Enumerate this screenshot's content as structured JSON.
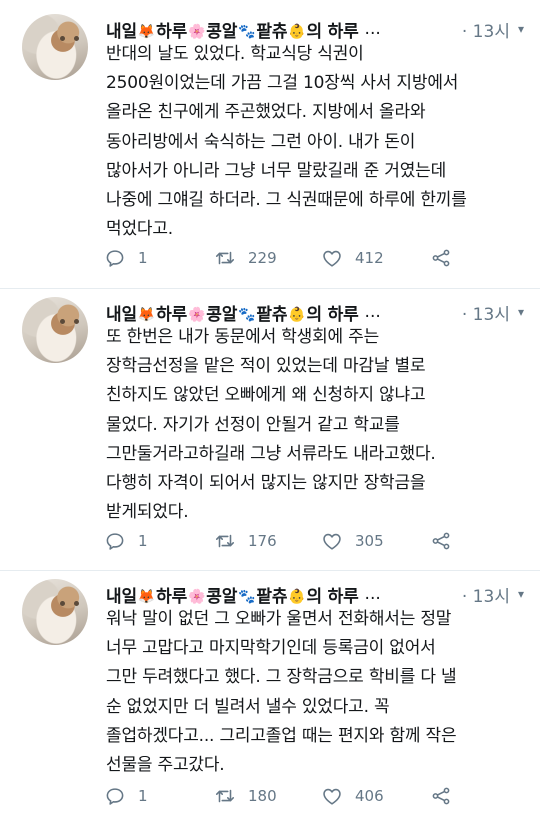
{
  "tweets": [
    {
      "author": "내일",
      "name_parts": [
        "하루",
        "콩알",
        "팥츄",
        "의 하루"
      ],
      "ellipsis": "...",
      "time": "· 13시",
      "lines": [
        "반대의 날도 있었다. 학교식당 식권이",
        "2500원이었는데 가끔 그걸 10장씩 사서 지방에서",
        "올라온 친구에게 주곤했었다. 지방에서 올라와",
        "동아리방에서 숙식하는 그런 아이. 내가 돈이",
        "많아서가 아니라 그냥 너무 말랐길래 준 거였는데",
        "나중에 그얘길 하더라. 그 식권때문에 하루에 한끼를",
        "먹었다고."
      ],
      "replies": "1",
      "retweets": "229",
      "likes": "412"
    },
    {
      "author": "내일",
      "name_parts": [
        "하루",
        "콩알",
        "팥츄",
        "의 하루"
      ],
      "ellipsis": "...",
      "time": "· 13시",
      "lines": [
        "또 한번은 내가 동문에서 학생회에 주는",
        "장학금선정을 맡은 적이 있었는데 마감날 별로",
        "친하지도 않았던 오빠에게 왜 신청하지 않냐고",
        "물었다. 자기가 선정이 안될거 같고 학교를",
        "그만둘거라고하길래 그냥 서류라도 내라고했다.",
        "다행히 자격이 되어서 많지는 않지만 장학금을",
        "받게되었다."
      ],
      "replies": "1",
      "retweets": "176",
      "likes": "305"
    },
    {
      "author": "내일",
      "name_parts": [
        "하루",
        "콩알",
        "팥츄",
        "의 하루"
      ],
      "ellipsis": "...",
      "time": "· 13시",
      "lines": [
        "워낙 말이 없던 그 오빠가 울면서 전화해서는 정말",
        "너무 고맙다고 마지막학기인데 등록금이 없어서",
        "그만 두려했다고 했다. 그 장학금으로 학비를 다 낼",
        "순 없었지만 더 빌려서 낼수 있었다고. 꼭",
        "졸업하겠다고... 그리고졸업 때는 편지와 함께 작은",
        "선물을 주고갔다."
      ],
      "replies": "1",
      "retweets": "180",
      "likes": "406"
    }
  ],
  "colors": {
    "text": "#14171a",
    "secondary": "#657786",
    "divider": "#e6ecf0"
  },
  "icons": [
    "reply-icon",
    "retweet-icon",
    "like-icon",
    "share-icon",
    "chevron-down-icon"
  ]
}
